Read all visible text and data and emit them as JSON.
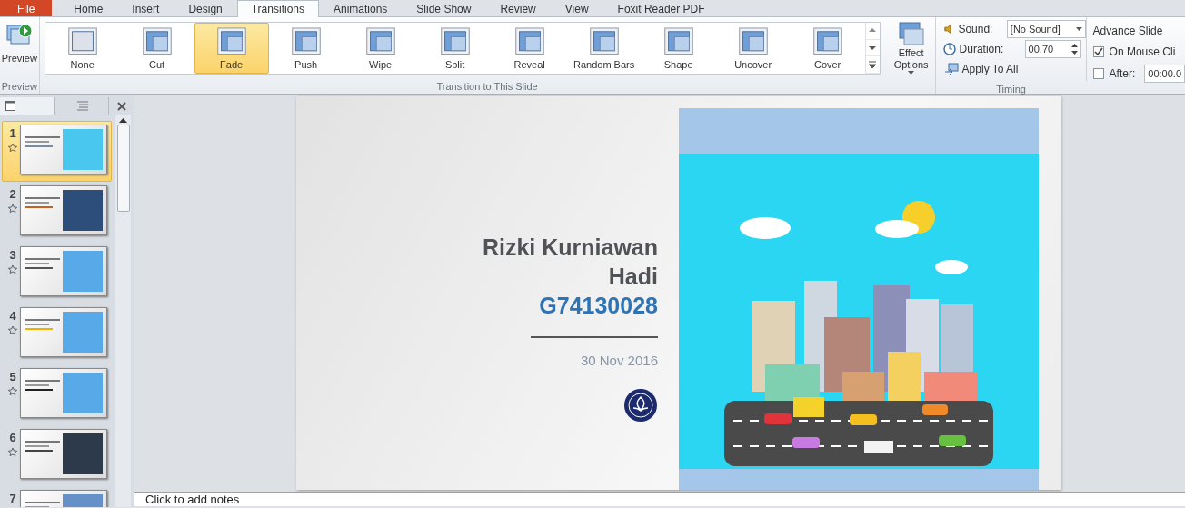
{
  "menu_tabs": [
    {
      "label": "File",
      "kind": "file",
      "selected": false
    },
    {
      "label": "Home",
      "kind": "tab",
      "selected": false
    },
    {
      "label": "Insert",
      "kind": "tab",
      "selected": false
    },
    {
      "label": "Design",
      "kind": "tab",
      "selected": false
    },
    {
      "label": "Transitions",
      "kind": "tab",
      "selected": true
    },
    {
      "label": "Animations",
      "kind": "tab",
      "selected": false
    },
    {
      "label": "Slide Show",
      "kind": "tab",
      "selected": false
    },
    {
      "label": "Review",
      "kind": "tab",
      "selected": false
    },
    {
      "label": "View",
      "kind": "tab",
      "selected": false
    },
    {
      "label": "Foxit Reader PDF",
      "kind": "tab",
      "selected": false
    }
  ],
  "ribbon": {
    "preview": {
      "label": "Preview",
      "group": "Preview"
    },
    "transitions": [
      {
        "label": "None",
        "selected": false
      },
      {
        "label": "Cut",
        "selected": false
      },
      {
        "label": "Fade",
        "selected": true
      },
      {
        "label": "Push",
        "selected": false
      },
      {
        "label": "Wipe",
        "selected": false
      },
      {
        "label": "Split",
        "selected": false
      },
      {
        "label": "Reveal",
        "selected": false
      },
      {
        "label": "Random Bars",
        "selected": false
      },
      {
        "label": "Shape",
        "selected": false
      },
      {
        "label": "Uncover",
        "selected": false
      },
      {
        "label": "Cover",
        "selected": false
      }
    ],
    "transition_group": "Transition to This Slide",
    "effect_options": "Effect Options",
    "timing": {
      "sound_label": "Sound:",
      "sound_value": "[No Sound]",
      "duration_label": "Duration:",
      "duration_value": "00.70",
      "apply_all": "Apply To All",
      "advance_title": "Advance Slide",
      "on_mouse": {
        "label": "On Mouse Cli",
        "checked": true
      },
      "after": {
        "label": "After:",
        "checked": false,
        "value": "00:00.0"
      },
      "group": "Timing"
    }
  },
  "slides": [
    {
      "number": "1",
      "selected": true
    },
    {
      "number": "2",
      "selected": false
    },
    {
      "number": "3",
      "selected": false
    },
    {
      "number": "4",
      "selected": false
    },
    {
      "number": "5",
      "selected": false
    },
    {
      "number": "6",
      "selected": false
    },
    {
      "number": "7",
      "selected": false
    }
  ],
  "slide": {
    "name_lines": [
      "Rizki Kurniawan",
      "Hadi"
    ],
    "student_id": "G74130028",
    "date": "30 Nov 2016"
  },
  "notes": {
    "placeholder": "Click to add notes"
  }
}
